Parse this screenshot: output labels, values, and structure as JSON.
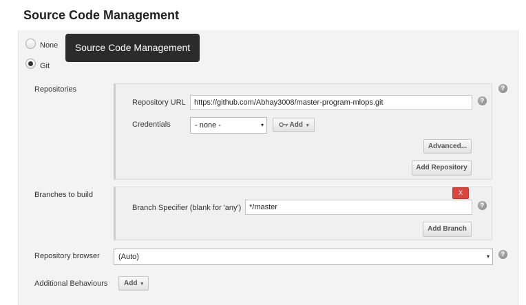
{
  "section_title": "Source Code Management",
  "tooltip": "Source Code Management",
  "scm_options": {
    "none_label": "None",
    "git_label": "Git",
    "selected": "Git"
  },
  "repositories": {
    "label": "Repositories",
    "url_label": "Repository URL",
    "url_value": "https://github.com/Abhay3008/master-program-mlops.git",
    "credentials_label": "Credentials",
    "credentials_value": "- none -",
    "add_label": "Add",
    "advanced_label": "Advanced...",
    "add_repository_label": "Add Repository"
  },
  "branches": {
    "label": "Branches to build",
    "delete_label": "X",
    "specifier_label": "Branch Specifier (blank for 'any')",
    "specifier_value": "*/master",
    "add_branch_label": "Add Branch"
  },
  "repository_browser": {
    "label": "Repository browser",
    "value": "(Auto)"
  },
  "additional_behaviours": {
    "label": "Additional Behaviours",
    "add_label": "Add"
  },
  "help_glyph": "?",
  "caret_glyph": "▾",
  "icons": {
    "help": "help-icon",
    "credentials": "key-icon",
    "dropdown": "caret-down-icon",
    "radio": "radio-icon"
  }
}
